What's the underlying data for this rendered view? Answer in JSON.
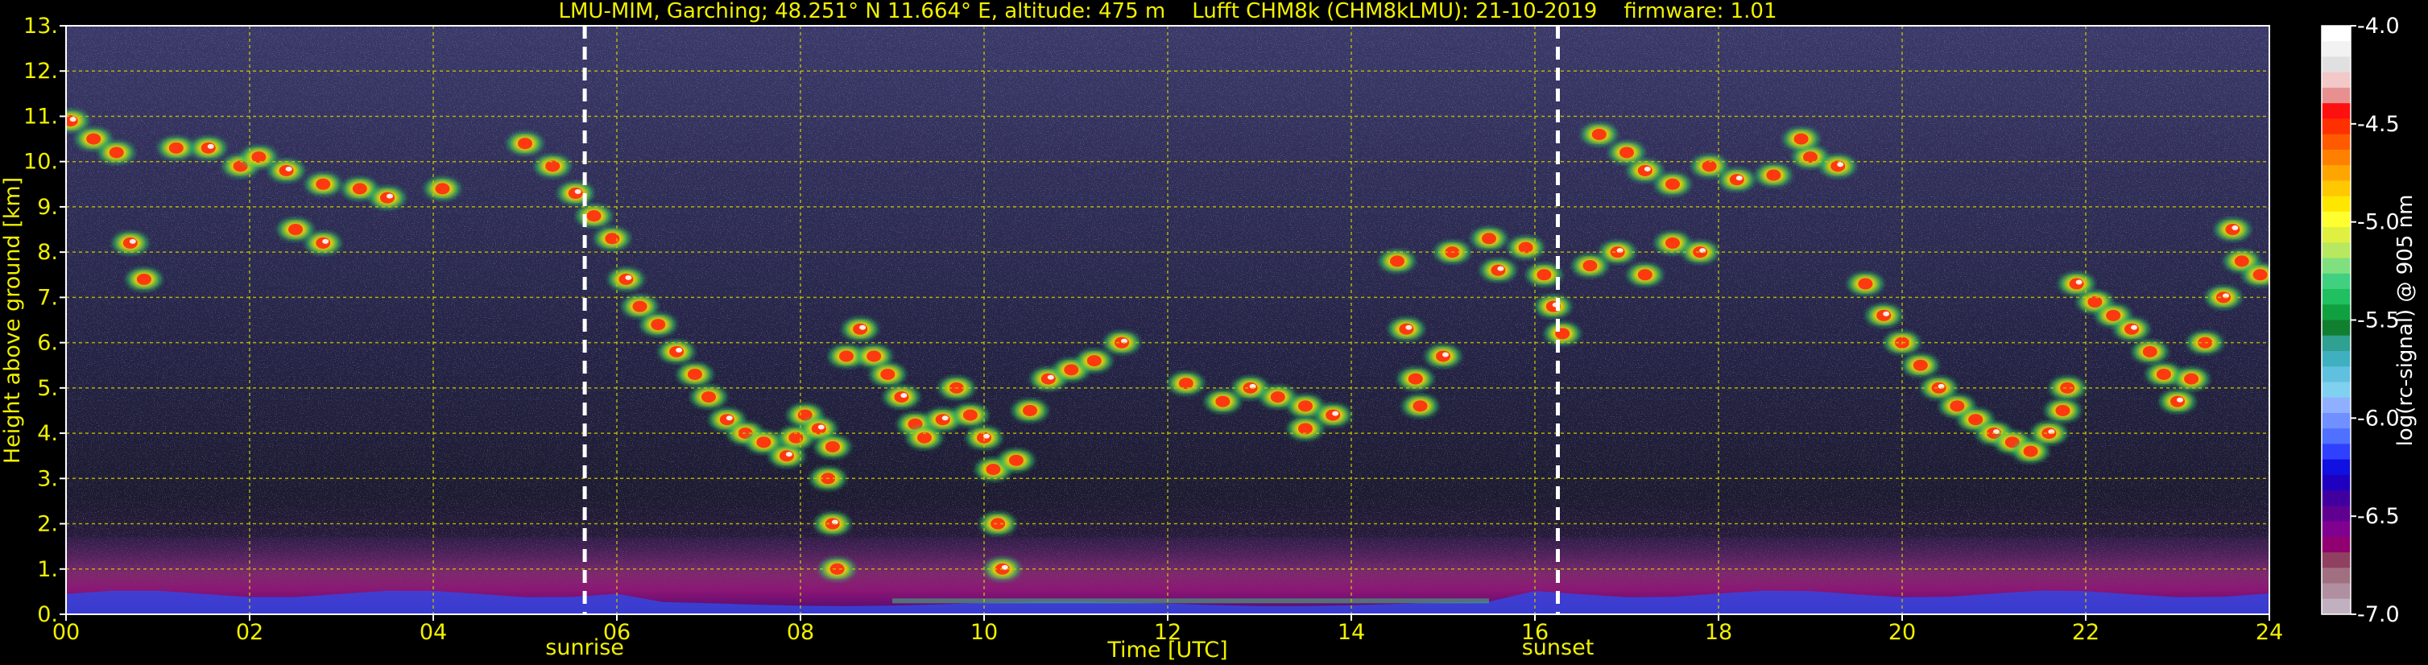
{
  "chart_data": {
    "type": "heatmap",
    "title": "LMU-MIM, Garching; 48.251° N 11.664° E, altitude: 475 m    Lufft CHM8k (CHM8kLMU): 21-10-2019    firmware: 1.01",
    "xlabel": "Time [UTC]",
    "ylabel": "Height above ground [km]",
    "xlim": [
      0,
      24
    ],
    "ylim": [
      0,
      13
    ],
    "x_ticks": [
      "00",
      "02",
      "04",
      "06",
      "08",
      "10",
      "12",
      "14",
      "16",
      "18",
      "20",
      "22",
      "24"
    ],
    "y_ticks": [
      "0.",
      "1.",
      "2.",
      "3.",
      "4.",
      "5.",
      "6.",
      "7.",
      "8.",
      "9.",
      "10.",
      "11.",
      "12.",
      "13."
    ],
    "grid": true,
    "events": [
      {
        "label": "sunrise",
        "time": 5.65
      },
      {
        "label": "sunset",
        "time": 16.25
      }
    ],
    "colorbar": {
      "label": "log(rc-signal) @ 905 nm",
      "range": [
        -7.0,
        -4.0
      ],
      "ticks": [
        "-4.0",
        "-4.5",
        "-5.0",
        "-5.5",
        "-6.0",
        "-6.5",
        "-7.0"
      ],
      "colors": [
        "#ffffff",
        "#f2f2f2",
        "#e0e0e0",
        "#f2c8c8",
        "#e89090",
        "#ff1010",
        "#ff3000",
        "#ff5a00",
        "#ff8000",
        "#ffa500",
        "#ffc800",
        "#ffe600",
        "#ffff30",
        "#e0f040",
        "#b8e860",
        "#80e080",
        "#40d080",
        "#20c060",
        "#10a040",
        "#108030",
        "#30a090",
        "#40b0c0",
        "#60c0e0",
        "#80d0f0",
        "#90b0ff",
        "#7090ff",
        "#5070ff",
        "#3040ff",
        "#1010e0",
        "#2000c0",
        "#4000a0",
        "#600090",
        "#800090",
        "#900070",
        "#904060",
        "#a07080",
        "#b090a0",
        "#c0b0c0"
      ]
    },
    "layers": [
      {
        "name": "cloud",
        "points": [
          [
            0.05,
            10.9
          ],
          [
            0.3,
            10.5
          ],
          [
            0.55,
            10.2
          ],
          [
            0.7,
            8.2
          ],
          [
            0.85,
            7.4
          ],
          [
            1.2,
            10.3
          ],
          [
            1.55,
            10.3
          ],
          [
            1.9,
            9.9
          ],
          [
            2.1,
            10.1
          ],
          [
            2.4,
            9.8
          ],
          [
            2.8,
            9.5
          ],
          [
            3.2,
            9.4
          ],
          [
            3.5,
            9.2
          ],
          [
            4.1,
            9.4
          ],
          [
            2.5,
            8.5
          ],
          [
            2.8,
            8.2
          ],
          [
            5.0,
            10.4
          ],
          [
            5.3,
            9.9
          ],
          [
            5.55,
            9.3
          ],
          [
            5.75,
            8.8
          ],
          [
            5.95,
            8.3
          ],
          [
            6.1,
            7.4
          ],
          [
            6.25,
            6.8
          ],
          [
            6.45,
            6.4
          ],
          [
            6.65,
            5.8
          ],
          [
            6.85,
            5.3
          ],
          [
            7.0,
            4.8
          ],
          [
            7.2,
            4.3
          ],
          [
            7.4,
            4.0
          ],
          [
            7.6,
            3.8
          ],
          [
            7.85,
            3.5
          ],
          [
            7.95,
            3.9
          ],
          [
            8.05,
            4.4
          ],
          [
            8.2,
            4.1
          ],
          [
            8.35,
            3.7
          ],
          [
            8.3,
            3.0
          ],
          [
            8.35,
            2.0
          ],
          [
            8.4,
            1.0
          ],
          [
            8.5,
            5.7
          ],
          [
            8.65,
            6.3
          ],
          [
            8.8,
            5.7
          ],
          [
            8.95,
            5.3
          ],
          [
            9.1,
            4.8
          ],
          [
            9.25,
            4.2
          ],
          [
            9.35,
            3.9
          ],
          [
            9.55,
            4.3
          ],
          [
            9.7,
            5.0
          ],
          [
            9.85,
            4.4
          ],
          [
            10.0,
            3.9
          ],
          [
            10.1,
            3.2
          ],
          [
            10.15,
            2.0
          ],
          [
            10.2,
            1.0
          ],
          [
            10.35,
            3.4
          ],
          [
            10.5,
            4.5
          ],
          [
            10.7,
            5.2
          ],
          [
            10.95,
            5.4
          ],
          [
            11.2,
            5.6
          ],
          [
            11.5,
            6.0
          ],
          [
            12.2,
            5.1
          ],
          [
            12.6,
            4.7
          ],
          [
            12.9,
            5.0
          ],
          [
            13.2,
            4.8
          ],
          [
            13.5,
            4.6
          ],
          [
            13.8,
            4.4
          ],
          [
            13.5,
            4.1
          ],
          [
            14.5,
            7.8
          ],
          [
            14.6,
            6.3
          ],
          [
            14.7,
            5.2
          ],
          [
            14.75,
            4.6
          ],
          [
            15.0,
            5.7
          ],
          [
            15.1,
            8.0
          ],
          [
            15.5,
            8.3
          ],
          [
            15.6,
            7.6
          ],
          [
            15.9,
            8.1
          ],
          [
            16.1,
            7.5
          ],
          [
            16.2,
            6.8
          ],
          [
            16.3,
            6.2
          ],
          [
            16.6,
            7.7
          ],
          [
            16.9,
            8.0
          ],
          [
            17.2,
            7.5
          ],
          [
            17.5,
            8.2
          ],
          [
            17.8,
            8.0
          ],
          [
            16.7,
            10.6
          ],
          [
            17.0,
            10.2
          ],
          [
            17.2,
            9.8
          ],
          [
            17.5,
            9.5
          ],
          [
            17.9,
            9.9
          ],
          [
            18.2,
            9.6
          ],
          [
            18.6,
            9.7
          ],
          [
            19.0,
            10.1
          ],
          [
            19.3,
            9.9
          ],
          [
            18.9,
            10.5
          ],
          [
            19.6,
            7.3
          ],
          [
            19.8,
            6.6
          ],
          [
            20.0,
            6.0
          ],
          [
            20.2,
            5.5
          ],
          [
            20.4,
            5.0
          ],
          [
            20.6,
            4.6
          ],
          [
            20.8,
            4.3
          ],
          [
            21.0,
            4.0
          ],
          [
            21.2,
            3.8
          ],
          [
            21.4,
            3.6
          ],
          [
            21.6,
            4.0
          ],
          [
            21.75,
            4.5
          ],
          [
            21.8,
            5.0
          ],
          [
            21.9,
            7.3
          ],
          [
            22.1,
            6.9
          ],
          [
            22.3,
            6.6
          ],
          [
            22.5,
            6.3
          ],
          [
            22.7,
            5.8
          ],
          [
            22.85,
            5.3
          ],
          [
            23.0,
            4.7
          ],
          [
            23.15,
            5.2
          ],
          [
            23.3,
            6.0
          ],
          [
            23.5,
            7.0
          ],
          [
            23.7,
            7.8
          ],
          [
            23.9,
            7.5
          ],
          [
            23.6,
            8.5
          ]
        ]
      },
      {
        "name": "boundary-layer",
        "points": []
      }
    ]
  }
}
